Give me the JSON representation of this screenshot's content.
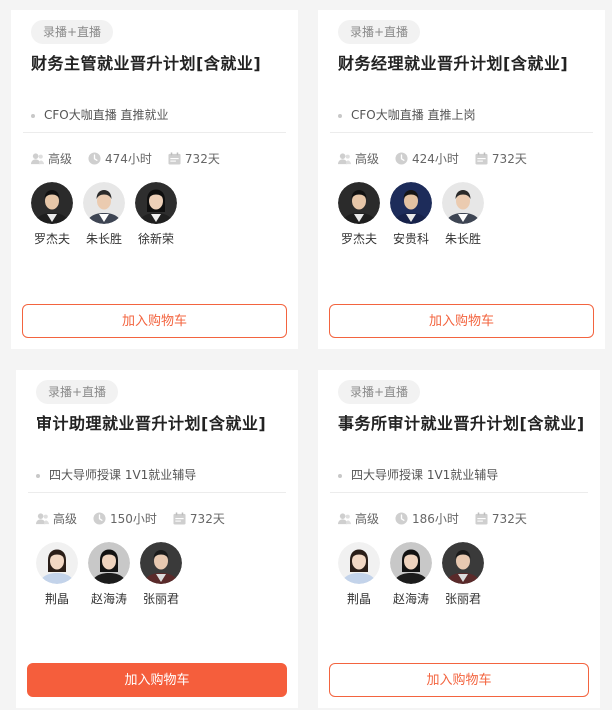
{
  "cards": [
    {
      "badge": "录播+直播",
      "title": "财务主管就业晋升计划[含就业]",
      "feature": "CFO大咖直播 直推就业",
      "level": "高级",
      "hours": "474小时",
      "days": "732天",
      "teachers": [
        {
          "name": "罗杰夫",
          "style": "man-dark"
        },
        {
          "name": "朱长胜",
          "style": "man-light"
        },
        {
          "name": "徐新荣",
          "style": "woman-dark"
        }
      ],
      "cart_label": "加入购物车",
      "cart_style": "outline"
    },
    {
      "badge": "录播+直播",
      "title": "财务经理就业晋升计划[含就业]",
      "feature": "CFO大咖直播 直推上岗",
      "level": "高级",
      "hours": "424小时",
      "days": "732天",
      "teachers": [
        {
          "name": "罗杰夫",
          "style": "man-dark"
        },
        {
          "name": "安贵科",
          "style": "man-navy"
        },
        {
          "name": "朱长胜",
          "style": "man-light"
        }
      ],
      "cart_label": "加入购物车",
      "cart_style": "outline"
    },
    {
      "badge": "录播+直播",
      "title": "审计助理就业晋升计划[含就业]",
      "feature": "四大导师授课 1V1就业辅导",
      "level": "高级",
      "hours": "150小时",
      "days": "732天",
      "teachers": [
        {
          "name": "荆晶",
          "style": "woman-light"
        },
        {
          "name": "赵海涛",
          "style": "woman-gray"
        },
        {
          "name": "张丽君",
          "style": "woman-dark2"
        }
      ],
      "cart_label": "加入购物车",
      "cart_style": "solid"
    },
    {
      "badge": "录播+直播",
      "title": "事务所审计就业晋升计划[含就业]",
      "feature": "四大导师授课 1V1就业辅导",
      "level": "高级",
      "hours": "186小时",
      "days": "732天",
      "teachers": [
        {
          "name": "荆晶",
          "style": "woman-light"
        },
        {
          "name": "赵海涛",
          "style": "woman-gray"
        },
        {
          "name": "张丽君",
          "style": "woman-dark2"
        }
      ],
      "cart_label": "加入购物车",
      "cart_style": "outline"
    }
  ],
  "icons": {
    "level": "level-icon",
    "hours": "clock-icon",
    "days": "calendar-icon"
  },
  "colors": {
    "accent": "#f55e3c",
    "badge_bg": "#f2f2f2"
  }
}
